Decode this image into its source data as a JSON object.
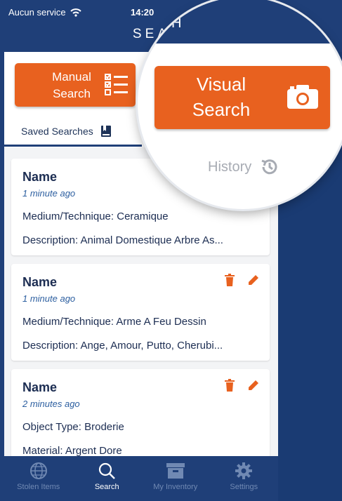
{
  "status": {
    "carrier": "Aucun service",
    "time": "14:20"
  },
  "header": {
    "title": "SEARCH",
    "title_zoom_fragment": "H"
  },
  "buttons": {
    "manual_line1": "Manual",
    "manual_line2": "Search",
    "visual_line1": "Visual",
    "visual_line2": "Search"
  },
  "tabs": {
    "saved_label": "Saved Searches",
    "history_label": "History"
  },
  "cards": [
    {
      "name": "Name",
      "time": "1 minute ago",
      "line1": "Medium/Technique: Ceramique",
      "line2": "Description: Animal Domestique Arbre As..."
    },
    {
      "name": "Name",
      "time": "1 minute ago",
      "line1": "Medium/Technique: Arme A Feu Dessin",
      "line2": "Description: Ange, Amour, Putto, Cherubi..."
    },
    {
      "name": "Name",
      "time": "2 minutes ago",
      "line1": "Object Type: Broderie",
      "line2": "Material: Argent Dore"
    }
  ],
  "tabbar": [
    {
      "label": "Stolen Items",
      "icon": "globe-icon",
      "active": false
    },
    {
      "label": "Search",
      "icon": "search-icon",
      "active": true
    },
    {
      "label": "My Inventory",
      "icon": "archive-box-icon",
      "active": false
    },
    {
      "label": "Settings",
      "icon": "gear-icon",
      "active": false
    }
  ],
  "colors": {
    "primary_navy": "#1f3f78",
    "accent_orange": "#e8611f",
    "history_gray": "#a7abb3"
  }
}
